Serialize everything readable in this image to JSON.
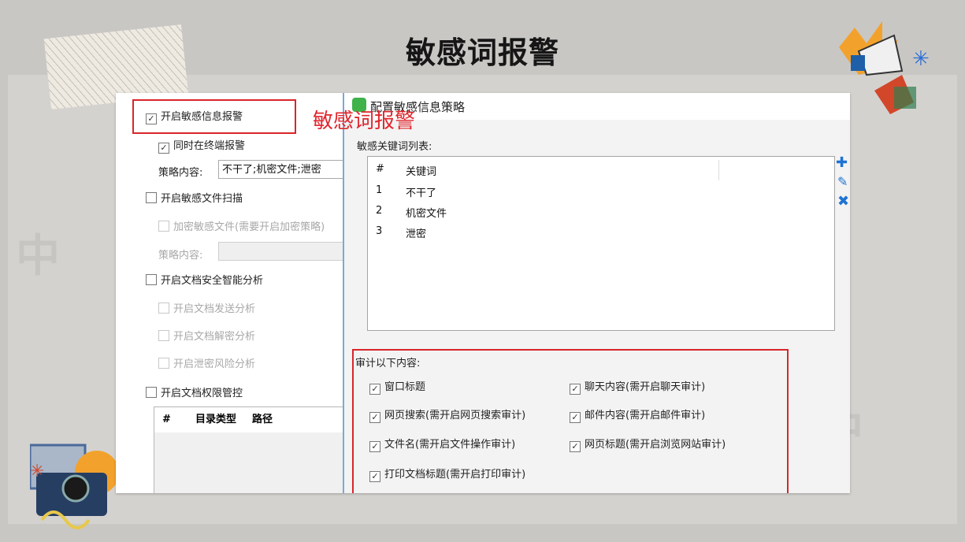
{
  "slide_title": "敏感词报警",
  "annotation_label": "敏感词报警",
  "left_panel": {
    "enable_sensitive_alert": "开启敏感信息报警",
    "terminal_alert": "同时在终端报警",
    "policy_label": "策略内容:",
    "policy_value": "不干了;机密文件;泄密",
    "enable_file_scan": "开启敏感文件扫描",
    "encrypt_files": "加密敏感文件(需要开启加密策略)",
    "policy_label_2": "策略内容:",
    "enable_doc_analysis": "开启文档安全智能分析",
    "doc_send_analysis": "开启文档发送分析",
    "doc_decrypt_analysis": "开启文档解密分析",
    "leak_risk_analysis": "开启泄密风险分析",
    "enable_doc_permission": "开启文档权限管控",
    "table_headers": [
      "#",
      "目录类型",
      "路径"
    ]
  },
  "dialog": {
    "title": "配置敏感信息策略",
    "keyword_list_label": "敏感关键词列表:",
    "list_headers": [
      "#",
      "关键词"
    ],
    "keywords": [
      {
        "no": "1",
        "word": "不干了"
      },
      {
        "no": "2",
        "word": "机密文件"
      },
      {
        "no": "3",
        "word": "泄密"
      }
    ],
    "audit_label": "审计以下内容:",
    "audit_items": [
      "窗口标题",
      "聊天内容(需开启聊天审计)",
      "网页搜索(需开启网页搜索审计)",
      "邮件内容(需开启邮件审计)",
      "文件名(需开启文件操作审计)",
      "网页标题(需开启浏览网站审计)",
      "打印文档标题(需开启打印审计)"
    ]
  },
  "icons": {
    "add": "plus-icon",
    "edit": "pencil-icon",
    "delete": "x-icon",
    "checkmark": "check-icon"
  },
  "colors": {
    "highlight_red": "#d9252a",
    "accent_blue": "#1e73d2"
  }
}
